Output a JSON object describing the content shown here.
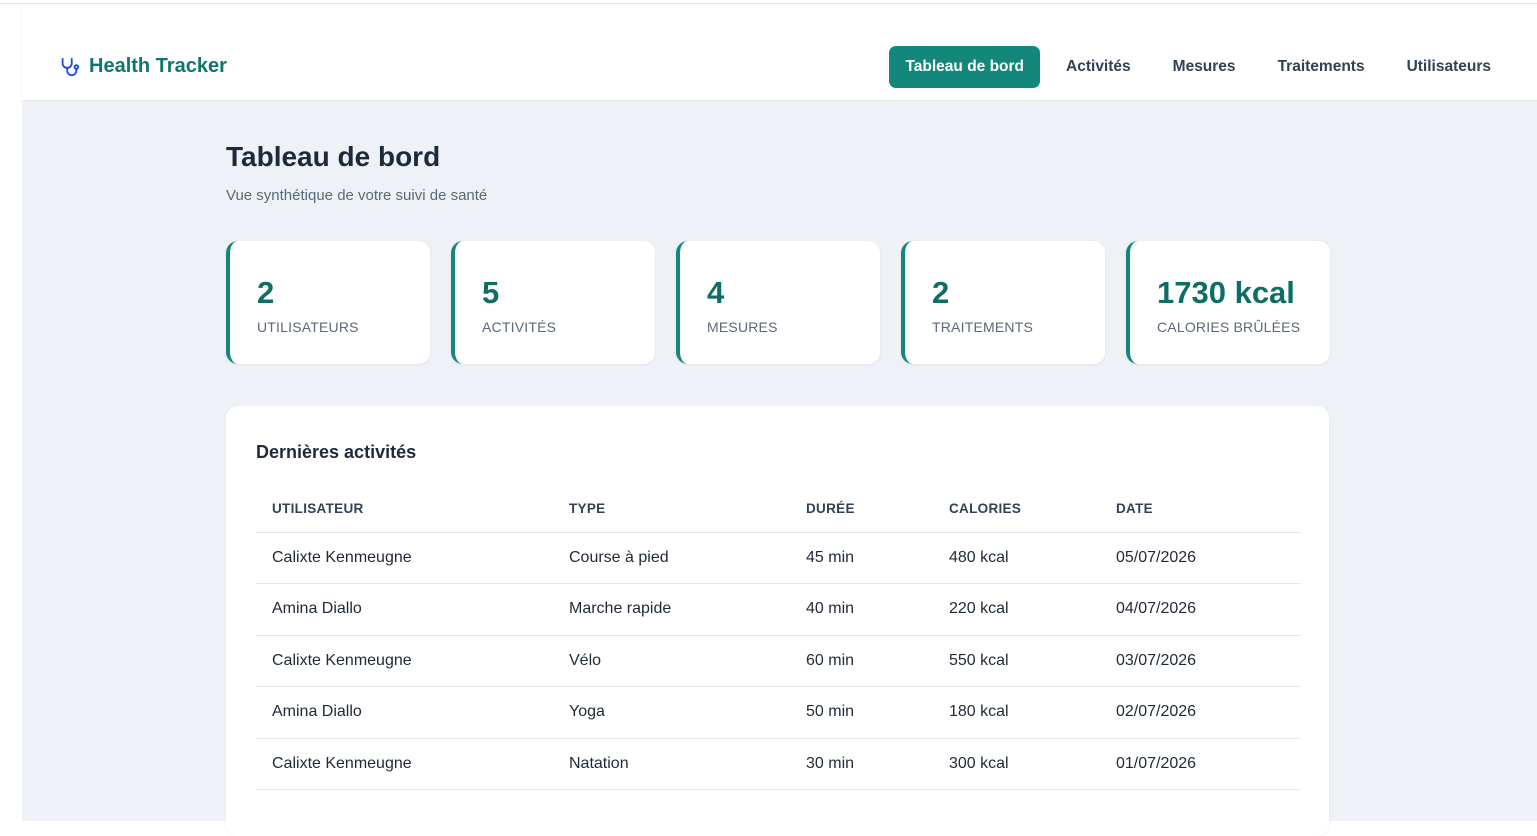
{
  "brand": {
    "name": "Health Tracker",
    "icon": "stethoscope-icon",
    "color": "#0f766e"
  },
  "nav": {
    "items": [
      {
        "label": "Tableau de bord",
        "active": true
      },
      {
        "label": "Activités",
        "active": false
      },
      {
        "label": "Mesures",
        "active": false
      },
      {
        "label": "Traitements",
        "active": false
      },
      {
        "label": "Utilisateurs",
        "active": false
      }
    ]
  },
  "header": {
    "title": "Tableau de bord",
    "subtitle": "Vue synthétique de votre suivi de santé"
  },
  "stats": [
    {
      "value": "2",
      "label": "Utilisateurs"
    },
    {
      "value": "5",
      "label": "Activités"
    },
    {
      "value": "4",
      "label": "Mesures"
    },
    {
      "value": "2",
      "label": "Traitements"
    },
    {
      "value": "1730 kcal",
      "label": "Calories brûlées"
    }
  ],
  "recent": {
    "title": "Dernières activités",
    "columns": [
      "UTILISATEUR",
      "TYPE",
      "DURÉE",
      "CALORIES",
      "DATE"
    ],
    "rows": [
      [
        "Calixte Kenmeugne",
        "Course à pied",
        "45 min",
        "480 kcal",
        "05/07/2026"
      ],
      [
        "Amina Diallo",
        "Marche rapide",
        "40 min",
        "220 kcal",
        "04/07/2026"
      ],
      [
        "Calixte Kenmeugne",
        "Vélo",
        "60 min",
        "550 kcal",
        "03/07/2026"
      ],
      [
        "Amina Diallo",
        "Yoga",
        "50 min",
        "180 kcal",
        "02/07/2026"
      ],
      [
        "Calixte Kenmeugne",
        "Natation",
        "30 min",
        "300 kcal",
        "01/07/2026"
      ]
    ]
  },
  "colors": {
    "accent": "#13877b",
    "background": "#eef2f6"
  }
}
